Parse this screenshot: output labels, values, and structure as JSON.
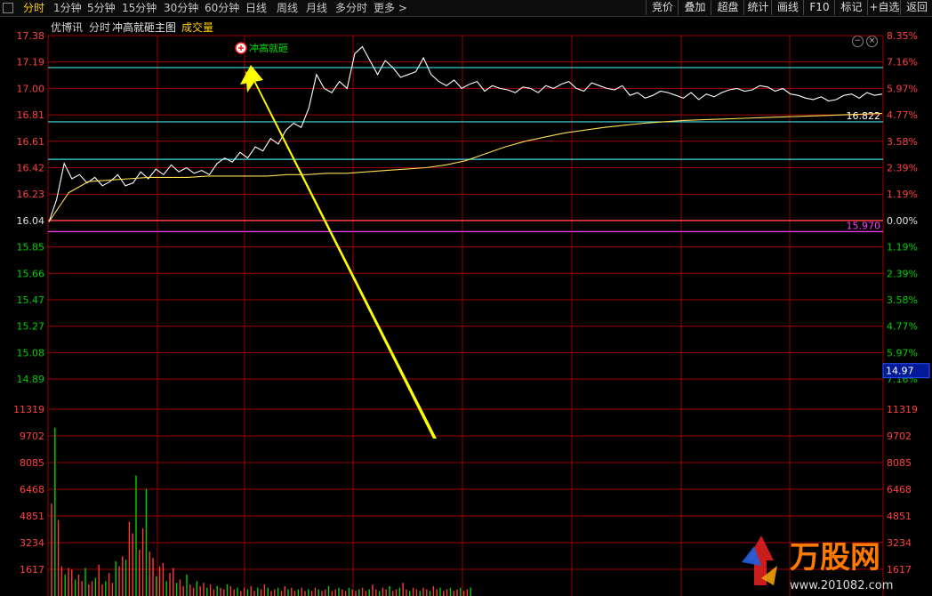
{
  "toolbar": {
    "left_items": [
      "分时",
      "1分钟",
      "5分钟",
      "15分钟",
      "30分钟",
      "60分钟",
      "日线",
      "周线",
      "月线",
      "多分时",
      "更多 >"
    ],
    "right_items": [
      "竞价",
      "叠加",
      "超盘",
      "统计",
      "画线",
      "F10",
      "标记",
      "+自选",
      "返回"
    ]
  },
  "subheader": {
    "stock_name": "优博讯",
    "mode": "分时",
    "chart_title": "冲高就砸主图",
    "volume_label": "成交量"
  },
  "colors": {
    "up": "#ff3b3b",
    "down": "#00d000",
    "price": "#ffffff",
    "avg": "#ffdd55",
    "grid": "#a00000",
    "cyan": "#40e0e0",
    "magenta": "#ff40ff"
  },
  "annotation": {
    "label": "冲高就砸",
    "icon": "plus-circle-icon"
  },
  "watermark": {
    "brand": "万股网",
    "url": "www.201082.com"
  },
  "chart_data": {
    "type": "line",
    "prev_close": 16.04,
    "price_axis": [
      "17.38",
      "17.19",
      "17.00",
      "16.81",
      "16.61",
      "16.42",
      "16.23",
      "16.04",
      "15.85",
      "15.66",
      "15.47",
      "15.27",
      "15.08",
      "14.89"
    ],
    "pct_axis": [
      "8.35%",
      "7.16%",
      "5.97%",
      "4.77%",
      "3.58%",
      "2.39%",
      "1.19%",
      "0.00%",
      "1.19%",
      "2.39%",
      "3.58%",
      "4.77%",
      "5.97%",
      "7.16%"
    ],
    "volume_axis": [
      "11319",
      "9702",
      "8085",
      "6468",
      "4851",
      "3234",
      "1617"
    ],
    "reference_lines": [
      {
        "price": 17.15,
        "color": "cyan"
      },
      {
        "price": 16.76,
        "color": "cyan",
        "label": "16.822"
      },
      {
        "price": 16.49,
        "color": "cyan"
      },
      {
        "price": 15.97,
        "color": "magenta",
        "label": "15.970"
      }
    ],
    "current_price_box": "14.97",
    "price": [
      16.04,
      16.2,
      16.46,
      16.35,
      16.38,
      16.32,
      16.36,
      16.3,
      16.33,
      16.38,
      16.3,
      16.32,
      16.4,
      16.35,
      16.42,
      16.38,
      16.45,
      16.4,
      16.43,
      16.39,
      16.41,
      16.38,
      16.46,
      16.5,
      16.47,
      16.54,
      16.5,
      16.58,
      16.55,
      16.64,
      16.6,
      16.7,
      16.75,
      16.72,
      16.86,
      17.1,
      17.0,
      16.97,
      17.05,
      17.0,
      17.25,
      17.3,
      17.2,
      17.1,
      17.2,
      17.15,
      17.08,
      17.1,
      17.12,
      17.22,
      17.1,
      17.05,
      17.02,
      17.06,
      17.0,
      17.03,
      17.05,
      16.98,
      17.02,
      17.0,
      16.99,
      16.97,
      17.01,
      17.0,
      16.97,
      17.02,
      17.0,
      17.03,
      17.05,
      17.0,
      16.98,
      17.04,
      17.02,
      17.0,
      16.99,
      17.02,
      16.95,
      16.97,
      16.93,
      16.95,
      16.98,
      16.97,
      16.95,
      16.93,
      16.97,
      16.92,
      16.96,
      16.94,
      16.97,
      16.99,
      17.0,
      16.98,
      16.99,
      17.02,
      17.01,
      16.98,
      17.0,
      16.96,
      16.95,
      16.93,
      16.92,
      16.94,
      16.91,
      16.92,
      16.95,
      16.96,
      16.93,
      16.97,
      16.95,
      16.96
    ],
    "avg": [
      16.04,
      16.25,
      16.33,
      16.34,
      16.35,
      16.36,
      16.36,
      16.36,
      16.37,
      16.37,
      16.37,
      16.37,
      16.38,
      16.38,
      16.39,
      16.39,
      16.4,
      16.41,
      16.42,
      16.43,
      16.45,
      16.48,
      16.53,
      16.58,
      16.62,
      16.65,
      16.68,
      16.7,
      16.72,
      16.735,
      16.75,
      16.76,
      16.77,
      16.775,
      16.78,
      16.785,
      16.79,
      16.795,
      16.8,
      16.805,
      16.81,
      16.815,
      16.82
    ],
    "volume": [
      5600,
      10200,
      4600,
      1800,
      1300,
      1700,
      1600,
      1000,
      1300,
      900,
      1700,
      700,
      900,
      1100,
      1900,
      700,
      900,
      1400,
      800,
      2100,
      1800,
      2400,
      2200,
      4500,
      3800,
      7300,
      2800,
      4100,
      6500,
      2700,
      2300,
      1200,
      1800,
      2000,
      900,
      1400,
      1700,
      800,
      1000,
      600,
      1300,
      700,
      500,
      900,
      600,
      800,
      500,
      700,
      400,
      600,
      500,
      400,
      700,
      600,
      400,
      500,
      300,
      500,
      400,
      600,
      300,
      500,
      400,
      700,
      500,
      300,
      400,
      500,
      300,
      600,
      400,
      500,
      300,
      400,
      500,
      300,
      400,
      300,
      500,
      400,
      300,
      400,
      600,
      300,
      400,
      500,
      400,
      300,
      500,
      400,
      300,
      400,
      500,
      300,
      400,
      700,
      400,
      300,
      500,
      400,
      600,
      300,
      400,
      500,
      800,
      400,
      300,
      500,
      400,
      300,
      500,
      400,
      300,
      600,
      400,
      500,
      300,
      400,
      500,
      300,
      400,
      500,
      300,
      400,
      500
    ]
  }
}
